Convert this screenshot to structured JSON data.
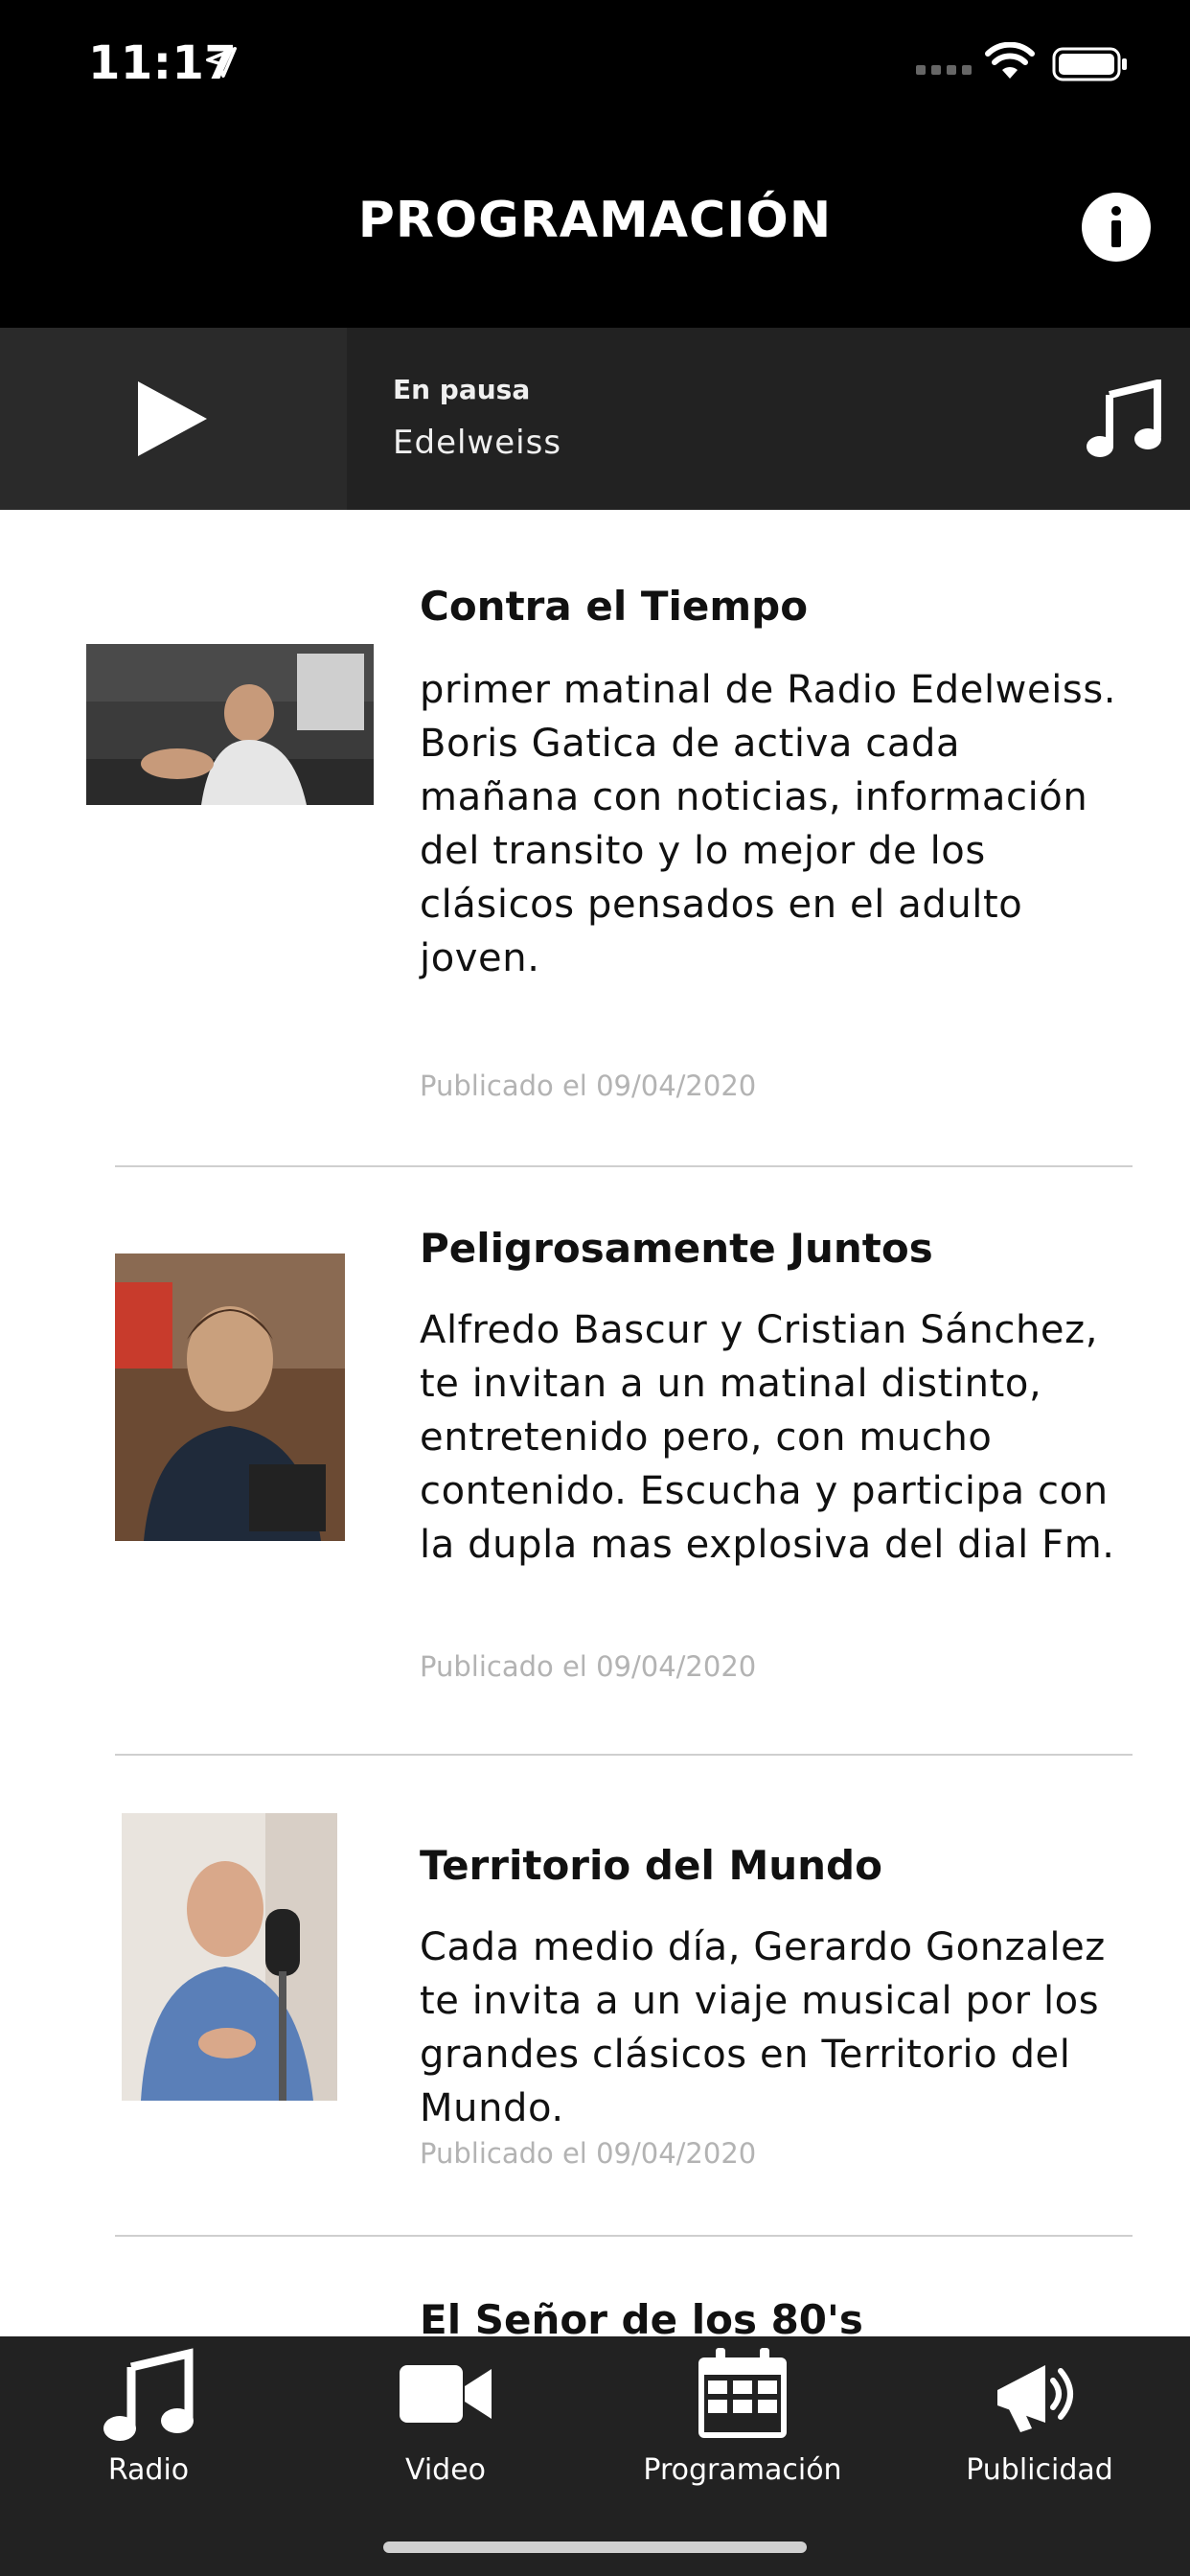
{
  "status_bar": {
    "time": "11:17"
  },
  "header": {
    "title": "PROGRAMACIÓN"
  },
  "player": {
    "status": "En pausa",
    "station": "Edelweiss"
  },
  "programs": [
    {
      "title": "Contra el Tiempo",
      "description": "primer matinal de Radio Edelweiss. Boris Gatica de activa cada mañana con noticias, información del transito y lo mejor de los clásicos pensados en el adulto joven.",
      "date": "Publicado el 09/04/2020"
    },
    {
      "title": "Peligrosamente Juntos",
      "description": "Alfredo Bascur y Cristian Sánchez, te invitan a un matinal distinto, entretenido pero, con mucho contenido. Escucha y participa con la dupla mas explosiva del dial Fm.",
      "date": "Publicado el 09/04/2020"
    },
    {
      "title": "Territorio del Mundo",
      "description": "Cada medio día, Gerardo Gonzalez te invita a un viaje musical por los grandes clásicos en Territorio del Mundo.",
      "date": "Publicado el 09/04/2020"
    },
    {
      "title": "El Señor de los 80's"
    }
  ],
  "tabs": [
    {
      "label": "Radio",
      "icon": "music-note-icon"
    },
    {
      "label": "Video",
      "icon": "video-camera-icon"
    },
    {
      "label": "Programación",
      "icon": "calendar-icon"
    },
    {
      "label": "Publicidad",
      "icon": "megaphone-icon"
    }
  ],
  "colors": {
    "header_bg": "#000000",
    "player_bg": "#222222",
    "tabbar_bg": "#222222",
    "date_text": "#b3b3b3"
  }
}
